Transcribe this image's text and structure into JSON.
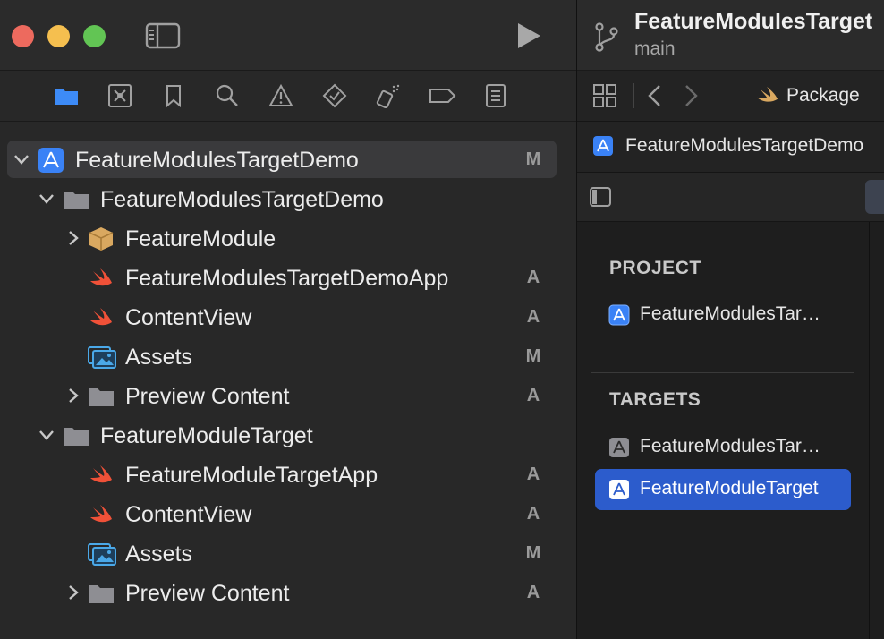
{
  "left": {
    "navigator_icons": [
      "folder-icon",
      "source-control-icon",
      "bookmark-icon",
      "search-icon",
      "warning-icon",
      "test-icon",
      "debug-icon",
      "breakpoint-icon",
      "report-icon"
    ],
    "tree": [
      {
        "label": "FeatureModulesTargetDemo",
        "status": "M"
      },
      {
        "label": "FeatureModulesTargetDemo",
        "status": ""
      },
      {
        "label": "FeatureModule",
        "status": ""
      },
      {
        "label": "FeatureModulesTargetDemoApp",
        "status": "A"
      },
      {
        "label": "ContentView",
        "status": "A"
      },
      {
        "label": "Assets",
        "status": "M"
      },
      {
        "label": "Preview Content",
        "status": "A"
      },
      {
        "label": "FeatureModuleTarget",
        "status": ""
      },
      {
        "label": "FeatureModuleTargetApp",
        "status": "A"
      },
      {
        "label": "ContentView",
        "status": "A"
      },
      {
        "label": "Assets",
        "status": "M"
      },
      {
        "label": "Preview Content",
        "status": "A"
      }
    ]
  },
  "right": {
    "project_title": "FeatureModulesTarget",
    "branch": "main",
    "breadcrumb_package": "Package",
    "jump_bar_label": "FeatureModulesTargetDemo",
    "project_header": "PROJECT",
    "project_item": "FeatureModulesTar…",
    "targets_header": "TARGETS",
    "targets": [
      "FeatureModulesTar…",
      "FeatureModuleTarget"
    ]
  },
  "colors": {
    "accent": "#2c5ccc",
    "swift": "#f05138",
    "folder": "#8e8e93",
    "app_icon": "#3a82f6"
  }
}
